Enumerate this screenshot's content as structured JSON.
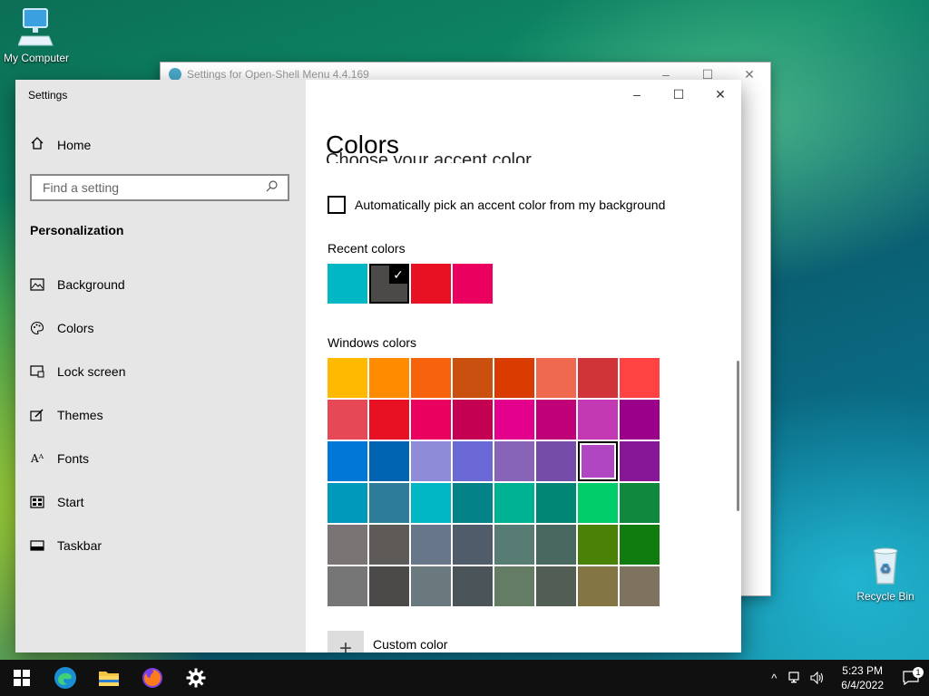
{
  "desktop": {
    "icons": [
      {
        "label": "My Computer"
      },
      {
        "label": "Recycle Bin"
      }
    ]
  },
  "background_window": {
    "title": "Settings for Open-Shell Menu 4.4.169"
  },
  "settings": {
    "app_title": "Settings",
    "home_label": "Home",
    "search_placeholder": "Find a setting",
    "section_title": "Personalization",
    "nav": [
      {
        "label": "Background",
        "icon": "background-icon"
      },
      {
        "label": "Colors",
        "icon": "palette-icon"
      },
      {
        "label": "Lock screen",
        "icon": "lock-screen-icon"
      },
      {
        "label": "Themes",
        "icon": "themes-icon"
      },
      {
        "label": "Fonts",
        "icon": "fonts-icon"
      },
      {
        "label": "Start",
        "icon": "start-icon"
      },
      {
        "label": "Taskbar",
        "icon": "taskbar-icon"
      }
    ],
    "page_title": "Colors",
    "scrolled_heading": "Choose your accent color",
    "auto_pick_label": "Automatically pick an accent color from my background",
    "auto_pick_checked": false,
    "recent_label": "Recent colors",
    "recent_colors": [
      "#00b7c3",
      "#4c4a48",
      "#e81123",
      "#ea005e"
    ],
    "recent_selected_index": 1,
    "windows_label": "Windows colors",
    "windows_colors": [
      "#ffb900",
      "#ff8c00",
      "#f7630c",
      "#ca5010",
      "#da3b01",
      "#ef6950",
      "#d13438",
      "#ff4343",
      "#e74856",
      "#e81123",
      "#ea005e",
      "#c30052",
      "#e3008c",
      "#bf0077",
      "#c239b3",
      "#9a0089",
      "#0078d7",
      "#0063b1",
      "#8e8cd8",
      "#6b69d6",
      "#8764b8",
      "#744da9",
      "#b146c2",
      "#881798",
      "#0099bc",
      "#2d7d9a",
      "#00b7c3",
      "#038387",
      "#00b294",
      "#018574",
      "#00cc6a",
      "#10893e",
      "#7a7574",
      "#5d5a58",
      "#68768a",
      "#515c6b",
      "#567c73",
      "#486860",
      "#498205",
      "#107c10",
      "#767676",
      "#4c4a48",
      "#69797e",
      "#4a5459",
      "#647c64",
      "#525e54",
      "#847545",
      "#7e735f"
    ],
    "windows_selected_index": 22,
    "custom_color_label": "Custom color"
  },
  "taskbar": {
    "apps": [
      "start-icon",
      "edge-icon",
      "file-explorer-icon",
      "firefox-icon",
      "settings-gear-icon"
    ],
    "time": "5:23 PM",
    "date": "6/4/2022",
    "notification_count": "1"
  }
}
